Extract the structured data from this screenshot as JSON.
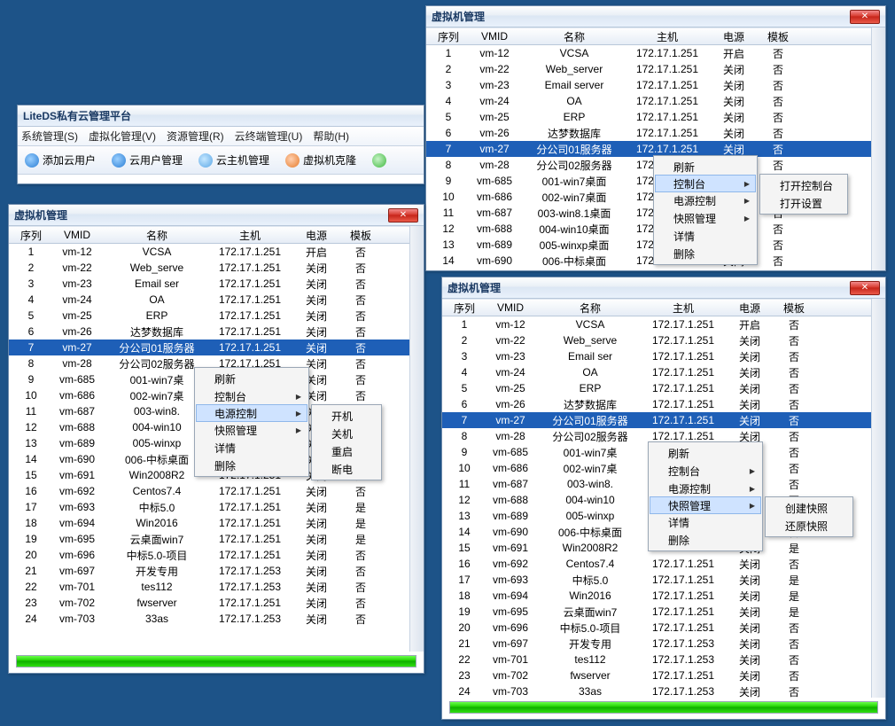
{
  "app_window": {
    "title": "LiteDS私有云管理平台",
    "menu": [
      "系统管理(S)",
      "虚拟化管理(V)",
      "资源管理(R)",
      "云终端管理(U)",
      "帮助(H)"
    ],
    "toolbar": [
      {
        "label": "添加云用户"
      },
      {
        "label": "云用户管理"
      },
      {
        "label": "云主机管理"
      },
      {
        "label": "虚拟机克隆"
      }
    ]
  },
  "vm_columns": [
    "序列",
    "VMID",
    "名称",
    "主机",
    "电源",
    "模板"
  ],
  "vm_rows_full": [
    {
      "seq": "1",
      "id": "vm-12",
      "name": "VCSA",
      "host": "172.17.1.251",
      "power": "开启",
      "tpl": "否"
    },
    {
      "seq": "2",
      "id": "vm-22",
      "name": "Web_server",
      "host": "172.17.1.251",
      "power": "关闭",
      "tpl": "否"
    },
    {
      "seq": "3",
      "id": "vm-23",
      "name": "Email server",
      "host": "172.17.1.251",
      "power": "关闭",
      "tpl": "否"
    },
    {
      "seq": "4",
      "id": "vm-24",
      "name": "OA",
      "host": "172.17.1.251",
      "power": "关闭",
      "tpl": "否"
    },
    {
      "seq": "5",
      "id": "vm-25",
      "name": "ERP",
      "host": "172.17.1.251",
      "power": "关闭",
      "tpl": "否"
    },
    {
      "seq": "6",
      "id": "vm-26",
      "name": "达梦数据库",
      "host": "172.17.1.251",
      "power": "关闭",
      "tpl": "否"
    },
    {
      "seq": "7",
      "id": "vm-27",
      "name": "分公司01服务器",
      "host": "172.17.1.251",
      "power": "关闭",
      "tpl": "否"
    },
    {
      "seq": "8",
      "id": "vm-28",
      "name": "分公司02服务器",
      "host": "172.17.1.251",
      "power": "关闭",
      "tpl": "否"
    },
    {
      "seq": "9",
      "id": "vm-685",
      "name": "001-win7桌面",
      "host": "172.17.1.251",
      "power": "关闭",
      "tpl": "否"
    },
    {
      "seq": "10",
      "id": "vm-686",
      "name": "002-win7桌面",
      "host": "172.17.1.251",
      "power": "关闭",
      "tpl": "否"
    },
    {
      "seq": "11",
      "id": "vm-687",
      "name": "003-win8.1桌面",
      "host": "172.17.1.251",
      "power": "关闭",
      "tpl": "否"
    },
    {
      "seq": "12",
      "id": "vm-688",
      "name": "004-win10桌面",
      "host": "172.17.1.251",
      "power": "关闭",
      "tpl": "否"
    },
    {
      "seq": "13",
      "id": "vm-689",
      "name": "005-winxp桌面",
      "host": "172.17.1.251",
      "power": "关闭",
      "tpl": "否"
    },
    {
      "seq": "14",
      "id": "vm-690",
      "name": "006-中标桌面",
      "host": "172.17.1.251",
      "power": "关闭",
      "tpl": "否"
    },
    {
      "seq": "15",
      "id": "vm-691",
      "name": "Win2008R2",
      "host": "172.17.1.251",
      "power": "关闭",
      "tpl": "是"
    },
    {
      "seq": "16",
      "id": "vm-692",
      "name": "Centos7.4",
      "host": "172.17.1.251",
      "power": "关闭",
      "tpl": "否"
    },
    {
      "seq": "17",
      "id": "vm-693",
      "name": "中标5.0",
      "host": "172.17.1.251",
      "power": "关闭",
      "tpl": "是"
    },
    {
      "seq": "18",
      "id": "vm-694",
      "name": "Win2016",
      "host": "172.17.1.251",
      "power": "关闭",
      "tpl": "是"
    },
    {
      "seq": "19",
      "id": "vm-695",
      "name": "云桌面win7",
      "host": "172.17.1.251",
      "power": "关闭",
      "tpl": "是"
    },
    {
      "seq": "20",
      "id": "vm-696",
      "name": "中标5.0-项目",
      "host": "172.17.1.251",
      "power": "关闭",
      "tpl": "否"
    },
    {
      "seq": "21",
      "id": "vm-697",
      "name": "开发专用",
      "host": "172.17.1.253",
      "power": "关闭",
      "tpl": "否"
    },
    {
      "seq": "22",
      "id": "vm-701",
      "name": "tes112",
      "host": "172.17.1.253",
      "power": "关闭",
      "tpl": "否"
    },
    {
      "seq": "23",
      "id": "vm-702",
      "name": "fwserver",
      "host": "172.17.1.251",
      "power": "关闭",
      "tpl": "否"
    },
    {
      "seq": "24",
      "id": "vm-703",
      "name": "33as",
      "host": "172.17.1.253",
      "power": "关闭",
      "tpl": "否"
    }
  ],
  "vm_title": "虚拟机管理",
  "ctx_main": {
    "refresh": "刷新",
    "console": "控制台",
    "power": "电源控制",
    "snapshot": "快照管理",
    "detail": "详情",
    "delete": "删除"
  },
  "ctx_power_sub": [
    "开机",
    "关机",
    "重启",
    "断电"
  ],
  "ctx_console_sub": [
    "打开控制台",
    "打开设置"
  ],
  "ctx_snapshot_sub": [
    "创建快照",
    "还原快照"
  ],
  "top_window_visible_rows": 14,
  "selected_row_index": 6,
  "colors": {
    "sel": "#1e5fb7"
  }
}
